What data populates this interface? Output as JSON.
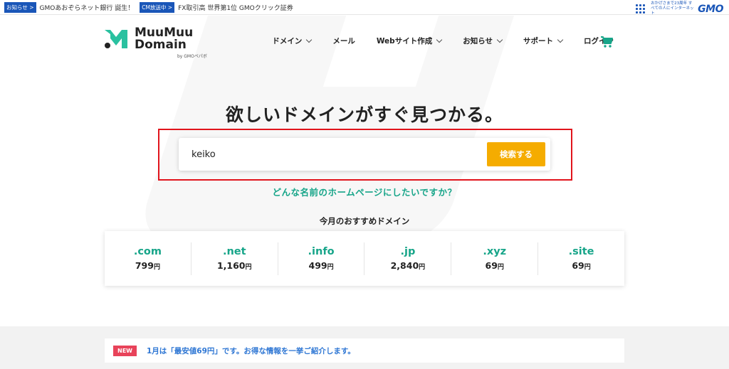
{
  "topbar": {
    "items": [
      {
        "tag": "お知らせ >",
        "text": "GMOあおぞらネット銀行 誕生！"
      },
      {
        "tag": "CM放送中 >",
        "text": "FX取引高 世界第1位 GMOクリック証券"
      }
    ],
    "gmo_tagline": "おかげさまで23周年 すべての人にインターネット",
    "gmo_logo": "GMO",
    "accent_color": "#1a56b8"
  },
  "header": {
    "logo_line1": "MuuMuu",
    "logo_line2": "Domain",
    "logo_by": "by GMOペパボ",
    "nav": [
      {
        "label": "ドメイン",
        "dropdown": true
      },
      {
        "label": "メール",
        "dropdown": false
      },
      {
        "label": "Webサイト作成",
        "dropdown": true
      },
      {
        "label": "お知らせ",
        "dropdown": true
      },
      {
        "label": "サポート",
        "dropdown": true
      },
      {
        "label": "ログイン",
        "dropdown": false
      }
    ],
    "cart_icon": "cart-icon",
    "brand_color": "#17a589"
  },
  "hero": {
    "title": "欲しいドメインがすぐ見つかる。",
    "search_value": "keiko",
    "search_button": "検索する",
    "help_link": "どんな名前のホームページにしたいですか？"
  },
  "recommend": {
    "title": "今月のおすすめドメイン",
    "currency": "円",
    "items": [
      {
        "tld": ".com",
        "price": "799"
      },
      {
        "tld": ".net",
        "price": "1,160"
      },
      {
        "tld": ".info",
        "price": "499"
      },
      {
        "tld": ".jp",
        "price": "2,840"
      },
      {
        "tld": ".xyz",
        "price": "69"
      },
      {
        "tld": ".site",
        "price": "69"
      }
    ]
  },
  "news": {
    "badge": "NEW",
    "text": "1月は「最安値69円」です。お得な情報を一挙ご紹介します。"
  }
}
